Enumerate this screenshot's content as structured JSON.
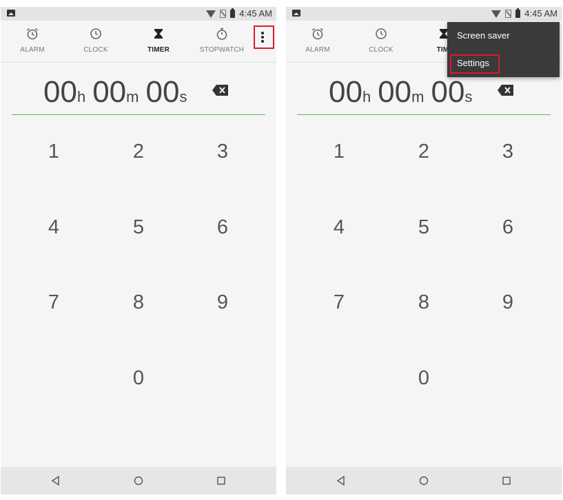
{
  "status_bar": {
    "time": "4:45 AM"
  },
  "tabs": [
    {
      "label": "ALARM",
      "icon": "alarm-icon"
    },
    {
      "label": "CLOCK",
      "icon": "clock-icon"
    },
    {
      "label": "TIMER",
      "icon": "hourglass-icon"
    },
    {
      "label": "STOPWATCH",
      "icon": "stopwatch-icon"
    }
  ],
  "right_tabs": [
    {
      "label": "ALARM"
    },
    {
      "label": "CLOCK"
    },
    {
      "label": "TIMI"
    }
  ],
  "timer": {
    "hours": "00",
    "hours_unit": "h",
    "minutes": "00",
    "minutes_unit": "m",
    "seconds": "00",
    "seconds_unit": "s"
  },
  "keypad": [
    "1",
    "2",
    "3",
    "4",
    "5",
    "6",
    "7",
    "8",
    "9",
    "0"
  ],
  "overflow_menu": {
    "items": [
      "Screen saver",
      "Settings"
    ]
  },
  "accent_color": "#5cb85c",
  "highlight_color": "#e0192a"
}
